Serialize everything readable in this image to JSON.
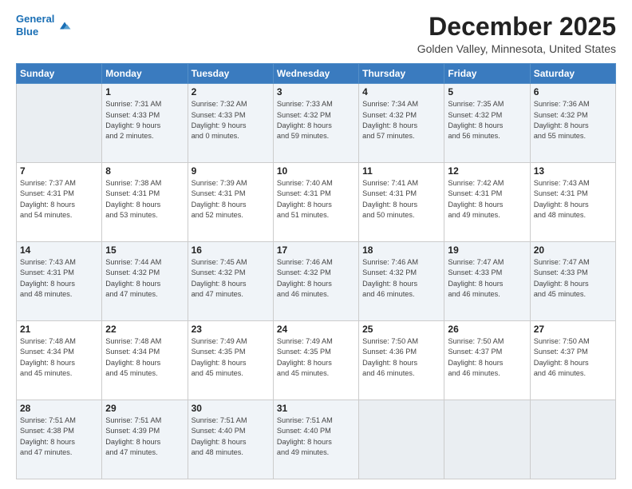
{
  "header": {
    "logo_line1": "General",
    "logo_line2": "Blue",
    "month": "December 2025",
    "location": "Golden Valley, Minnesota, United States"
  },
  "days_of_week": [
    "Sunday",
    "Monday",
    "Tuesday",
    "Wednesday",
    "Thursday",
    "Friday",
    "Saturday"
  ],
  "weeks": [
    [
      {
        "num": "",
        "info": ""
      },
      {
        "num": "1",
        "info": "Sunrise: 7:31 AM\nSunset: 4:33 PM\nDaylight: 9 hours\nand 2 minutes."
      },
      {
        "num": "2",
        "info": "Sunrise: 7:32 AM\nSunset: 4:33 PM\nDaylight: 9 hours\nand 0 minutes."
      },
      {
        "num": "3",
        "info": "Sunrise: 7:33 AM\nSunset: 4:32 PM\nDaylight: 8 hours\nand 59 minutes."
      },
      {
        "num": "4",
        "info": "Sunrise: 7:34 AM\nSunset: 4:32 PM\nDaylight: 8 hours\nand 57 minutes."
      },
      {
        "num": "5",
        "info": "Sunrise: 7:35 AM\nSunset: 4:32 PM\nDaylight: 8 hours\nand 56 minutes."
      },
      {
        "num": "6",
        "info": "Sunrise: 7:36 AM\nSunset: 4:32 PM\nDaylight: 8 hours\nand 55 minutes."
      }
    ],
    [
      {
        "num": "7",
        "info": "Sunrise: 7:37 AM\nSunset: 4:31 PM\nDaylight: 8 hours\nand 54 minutes."
      },
      {
        "num": "8",
        "info": "Sunrise: 7:38 AM\nSunset: 4:31 PM\nDaylight: 8 hours\nand 53 minutes."
      },
      {
        "num": "9",
        "info": "Sunrise: 7:39 AM\nSunset: 4:31 PM\nDaylight: 8 hours\nand 52 minutes."
      },
      {
        "num": "10",
        "info": "Sunrise: 7:40 AM\nSunset: 4:31 PM\nDaylight: 8 hours\nand 51 minutes."
      },
      {
        "num": "11",
        "info": "Sunrise: 7:41 AM\nSunset: 4:31 PM\nDaylight: 8 hours\nand 50 minutes."
      },
      {
        "num": "12",
        "info": "Sunrise: 7:42 AM\nSunset: 4:31 PM\nDaylight: 8 hours\nand 49 minutes."
      },
      {
        "num": "13",
        "info": "Sunrise: 7:43 AM\nSunset: 4:31 PM\nDaylight: 8 hours\nand 48 minutes."
      }
    ],
    [
      {
        "num": "14",
        "info": "Sunrise: 7:43 AM\nSunset: 4:31 PM\nDaylight: 8 hours\nand 48 minutes."
      },
      {
        "num": "15",
        "info": "Sunrise: 7:44 AM\nSunset: 4:32 PM\nDaylight: 8 hours\nand 47 minutes."
      },
      {
        "num": "16",
        "info": "Sunrise: 7:45 AM\nSunset: 4:32 PM\nDaylight: 8 hours\nand 47 minutes."
      },
      {
        "num": "17",
        "info": "Sunrise: 7:46 AM\nSunset: 4:32 PM\nDaylight: 8 hours\nand 46 minutes."
      },
      {
        "num": "18",
        "info": "Sunrise: 7:46 AM\nSunset: 4:32 PM\nDaylight: 8 hours\nand 46 minutes."
      },
      {
        "num": "19",
        "info": "Sunrise: 7:47 AM\nSunset: 4:33 PM\nDaylight: 8 hours\nand 46 minutes."
      },
      {
        "num": "20",
        "info": "Sunrise: 7:47 AM\nSunset: 4:33 PM\nDaylight: 8 hours\nand 45 minutes."
      }
    ],
    [
      {
        "num": "21",
        "info": "Sunrise: 7:48 AM\nSunset: 4:34 PM\nDaylight: 8 hours\nand 45 minutes."
      },
      {
        "num": "22",
        "info": "Sunrise: 7:48 AM\nSunset: 4:34 PM\nDaylight: 8 hours\nand 45 minutes."
      },
      {
        "num": "23",
        "info": "Sunrise: 7:49 AM\nSunset: 4:35 PM\nDaylight: 8 hours\nand 45 minutes."
      },
      {
        "num": "24",
        "info": "Sunrise: 7:49 AM\nSunset: 4:35 PM\nDaylight: 8 hours\nand 45 minutes."
      },
      {
        "num": "25",
        "info": "Sunrise: 7:50 AM\nSunset: 4:36 PM\nDaylight: 8 hours\nand 46 minutes."
      },
      {
        "num": "26",
        "info": "Sunrise: 7:50 AM\nSunset: 4:37 PM\nDaylight: 8 hours\nand 46 minutes."
      },
      {
        "num": "27",
        "info": "Sunrise: 7:50 AM\nSunset: 4:37 PM\nDaylight: 8 hours\nand 46 minutes."
      }
    ],
    [
      {
        "num": "28",
        "info": "Sunrise: 7:51 AM\nSunset: 4:38 PM\nDaylight: 8 hours\nand 47 minutes."
      },
      {
        "num": "29",
        "info": "Sunrise: 7:51 AM\nSunset: 4:39 PM\nDaylight: 8 hours\nand 47 minutes."
      },
      {
        "num": "30",
        "info": "Sunrise: 7:51 AM\nSunset: 4:40 PM\nDaylight: 8 hours\nand 48 minutes."
      },
      {
        "num": "31",
        "info": "Sunrise: 7:51 AM\nSunset: 4:40 PM\nDaylight: 8 hours\nand 49 minutes."
      },
      {
        "num": "",
        "info": ""
      },
      {
        "num": "",
        "info": ""
      },
      {
        "num": "",
        "info": ""
      }
    ]
  ]
}
